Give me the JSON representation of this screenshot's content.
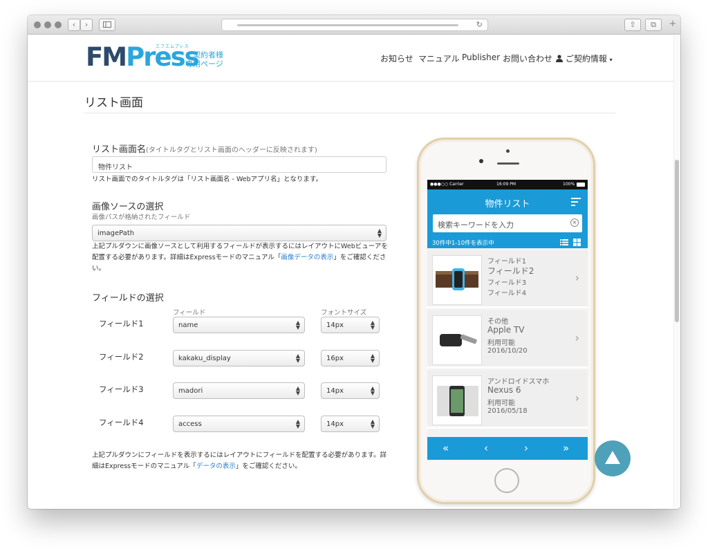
{
  "browser": {
    "back_icon": "chevron-left-icon",
    "forward_icon": "chevron-right-icon",
    "reload_glyph": "↻",
    "share_glyph": "⇧",
    "tabs_glyph": "⧉",
    "newtab_glyph": "+"
  },
  "header": {
    "logo_part1": "FM",
    "logo_part2": "Press",
    "logo_kana": "エフエムプレス",
    "logo_sub1": "ご契約者様",
    "logo_sub2": "専用ページ",
    "nav": [
      "お知らせ",
      "マニュアル",
      "Publisher",
      "お問い合わせ"
    ],
    "account": "ご契約情報"
  },
  "page": {
    "title": "リスト画面",
    "list_name": {
      "label": "リスト画面名",
      "note": "(タイトルタグとリスト画面のヘッダーに反映されます)",
      "value": "物件リスト",
      "help": "リスト画面でのタイトルタグは「リスト画面名 - Webアプリ名」となります。"
    },
    "image_source": {
      "label": "画像ソースの選択",
      "field_caption": "画像パスが格納されたフィールド",
      "value": "imagePath",
      "help_1": "上記プルダウンに画像ソースとして利用するフィールドが表示するにはレイアウトにWebビューアを",
      "help_2": "配置する必要があります。詳細はExpressモードのマニュアル「",
      "help_link": "画像データの表示",
      "help_3": "」をご確認くださ",
      "help_4": "い。"
    },
    "fields": {
      "label": "フィールドの選択",
      "col_field": "フィールド",
      "col_size": "フォントサイズ",
      "rows": [
        {
          "name": "フィールド1",
          "field": "name",
          "size": "14px"
        },
        {
          "name": "フィールド2",
          "field": "kakaku_display",
          "size": "16px"
        },
        {
          "name": "フィールド3",
          "field": "madori",
          "size": "14px"
        },
        {
          "name": "フィールド4",
          "field": "access",
          "size": "14px"
        }
      ],
      "help_1": "上記プルダウンにフィールドを表示するにはレイアウトにフィールドを配置する必要があります。詳",
      "help_2": "細はExpressモードのマニュアル「",
      "help_link": "データの表示",
      "help_3": "」をご確認ください。"
    }
  },
  "phone": {
    "status": {
      "carrier": "●●●○○ Carrier",
      "time": "16:09 PM",
      "battery": "100%"
    },
    "app_title": "物件リスト",
    "search_placeholder": "検索キーワードを入力",
    "count_text": "30件中1-10件を表示中",
    "items": [
      {
        "l1": "フィールド1",
        "l2": "フィールド2",
        "l3": "フィールド3",
        "l4": "フィールド4",
        "image": "apple-watch-image"
      },
      {
        "l1": "その他",
        "l2": "Apple TV",
        "l3": "利用可能",
        "l4": "2016/10/20",
        "image": "apple-tv-image"
      },
      {
        "l1": "アンドロイドスマホ",
        "l2": "Nexus 6",
        "l3": "利用可能",
        "l4": "2016/05/18",
        "image": "nexus-phone-image"
      }
    ],
    "pager": [
      "«",
      "‹",
      "›",
      "»"
    ]
  },
  "colors": {
    "accent": "#1a9ad6",
    "logo_dark": "#2d4a6b",
    "logo_light": "#2aa6df",
    "to_top": "#4fa1ba"
  }
}
